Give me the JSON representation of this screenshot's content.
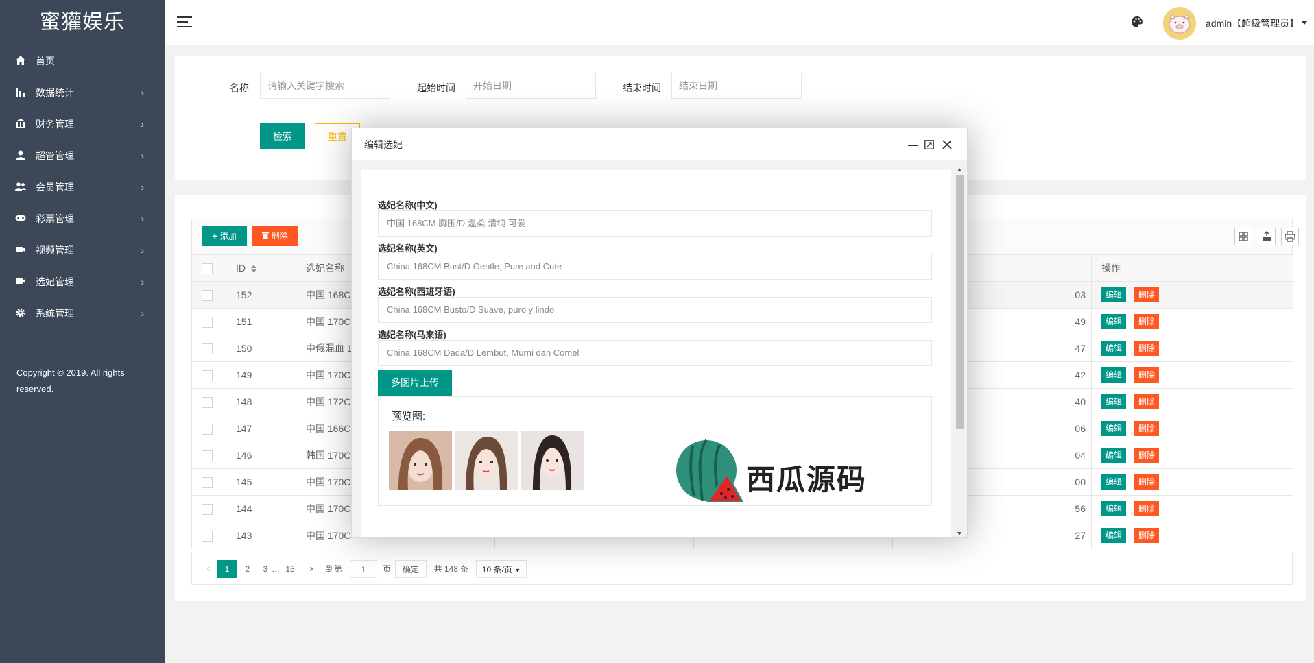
{
  "app": {
    "title": "蜜獾娱乐"
  },
  "sidebar": {
    "items": [
      {
        "label": "首页",
        "icon": "home-icon",
        "has_arrow": false
      },
      {
        "label": "数据统计",
        "icon": "bar-chart-icon",
        "has_arrow": true
      },
      {
        "label": "财务管理",
        "icon": "bank-icon",
        "has_arrow": true
      },
      {
        "label": "超管管理",
        "icon": "user-icon",
        "has_arrow": true
      },
      {
        "label": "会员管理",
        "icon": "users-icon",
        "has_arrow": true
      },
      {
        "label": "彩票管理",
        "icon": "gamepad-icon",
        "has_arrow": true
      },
      {
        "label": "视频管理",
        "icon": "video-icon",
        "has_arrow": true
      },
      {
        "label": "选妃管理",
        "icon": "camera-icon",
        "has_arrow": true
      },
      {
        "label": "系统管理",
        "icon": "gear-icon",
        "has_arrow": true
      }
    ],
    "arrow": "›",
    "copyright": "Copyright © 2019. All rights reserved."
  },
  "header": {
    "user": "admin【超级管理员】"
  },
  "search": {
    "name_label": "名称",
    "name_placeholder": "请输入关键字搜索",
    "start_label": "起始时间",
    "start_placeholder": "开始日期",
    "end_label": "结束时间",
    "end_placeholder": "结束日期",
    "search_button": "检索",
    "reset_button": "重置"
  },
  "toolbar": {
    "add_button": "添加",
    "add_icon": "plus-icon",
    "delete_button": "删除",
    "delete_icon": "trash-icon"
  },
  "table": {
    "headers": [
      "ID",
      "选妃名称",
      "操作"
    ],
    "edit_label": "编辑",
    "delete_label": "删除",
    "rows": [
      {
        "id": "152",
        "name": "中国 168C",
        "time_tail": "03"
      },
      {
        "id": "151",
        "name": "中国 170C",
        "time_tail": "49"
      },
      {
        "id": "150",
        "name": "中俄混血 1",
        "time_tail": "47"
      },
      {
        "id": "149",
        "name": "中国 170C",
        "time_tail": "42"
      },
      {
        "id": "148",
        "name": "中国 172C",
        "time_tail": "40"
      },
      {
        "id": "147",
        "name": "中国 166C",
        "time_tail": "06"
      },
      {
        "id": "146",
        "name": "韩国 170C",
        "time_tail": "04"
      },
      {
        "id": "145",
        "name": "中国 170C",
        "time_tail": "00"
      },
      {
        "id": "144",
        "name": "中国 170C",
        "time_tail": "56"
      },
      {
        "id": "143",
        "name": "中国 170C",
        "time_tail": "27"
      }
    ]
  },
  "pager": {
    "prev": "‹",
    "pages": [
      "1",
      "2",
      "3"
    ],
    "ellipsis": "…",
    "last_page": "15",
    "next": "›",
    "goto_label": "到第",
    "goto_value": "1",
    "page_unit": "页",
    "confirm": "确定",
    "total": "共 148 条",
    "page_size": "10 条/页"
  },
  "modal": {
    "title": "编辑选妃",
    "fields": [
      {
        "label": "选妃名称(中文)",
        "value": "中国   168CM  胸围/D   温柔  清纯  可爱"
      },
      {
        "label": "选妃名称(英文)",
        "value": "China 168CM Bust/D Gentle, Pure and Cute"
      },
      {
        "label": "选妃名称(西班牙语)",
        "value": "China 168CM Busto/D Suave, puro y lindo"
      },
      {
        "label": "选妃名称(马来语)",
        "value": "China 168CM Dada/D Lembut, Murni dan Comel"
      }
    ],
    "upload_button": "多图片上传",
    "preview_title": "预览图:"
  },
  "watermark": {
    "text": "西瓜源码"
  },
  "colors": {
    "sidebar_bg": "#3c4757",
    "primary": "#009688",
    "danger": "#ff5722",
    "warning": "#ffb800"
  }
}
